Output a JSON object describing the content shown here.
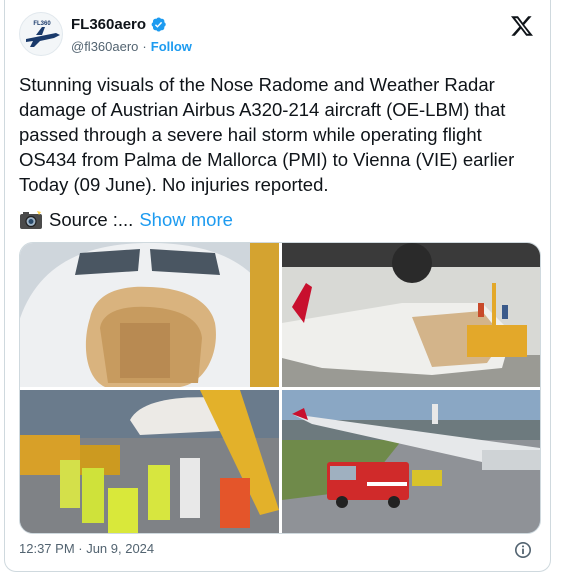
{
  "account": {
    "display_name": "FL360aero",
    "handle": "@fl360aero",
    "separator": "·",
    "follow_label": "Follow",
    "avatar_text": "FL360",
    "verified": true
  },
  "tweet": {
    "text": "Stunning visuals of the Nose Radome and Weather Radar damage of Austrian Airbus A320-214 aircraft (OE-LBM) that passed through a severe hail storm while operating flight OS434 from Palma de Mallorca (PMI) to Vienna (VIE) earlier Today (09 June). No injuries reported.",
    "source_label": "Source :...",
    "show_more_label": "Show more"
  },
  "media": {
    "photos": [
      {
        "description_icon": "damaged-nose-closeup"
      },
      {
        "description_icon": "aircraft-front-with-stairs"
      },
      {
        "description_icon": "ground-crew-at-aircraft"
      },
      {
        "description_icon": "fire-truck-on-apron"
      }
    ]
  },
  "footer": {
    "timestamp": "12:37 PM · Jun 9, 2024"
  },
  "colors": {
    "accent": "#1d9bf0",
    "text": "#0f1419",
    "muted": "#536471",
    "border": "#cfd9de"
  }
}
